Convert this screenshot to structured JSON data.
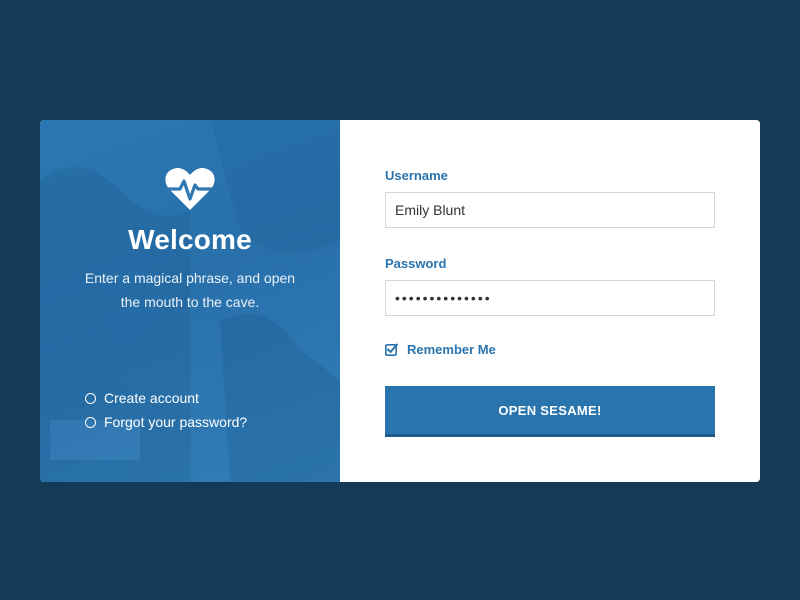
{
  "intro": {
    "title": "Welcome",
    "tagline": "Enter a magical phrase, and open the mouth to the cave."
  },
  "links": [
    {
      "label": "Create account"
    },
    {
      "label": "Forgot your password?"
    }
  ],
  "form": {
    "username_label": "Username",
    "username_value": "Emily Blunt",
    "password_label": "Password",
    "password_value": "••••••••••••••",
    "remember_label": "Remember Me",
    "remember_checked": true,
    "submit_label": "OPEN SESAME!"
  },
  "colors": {
    "page_bg": "#143a57",
    "panel_blue": "#2f78b2",
    "accent": "#2a74ae"
  },
  "icons": {
    "logo": "heart-pulse-icon",
    "link_bullet": "circle-icon",
    "checkbox": "checkbox-checked-icon"
  }
}
